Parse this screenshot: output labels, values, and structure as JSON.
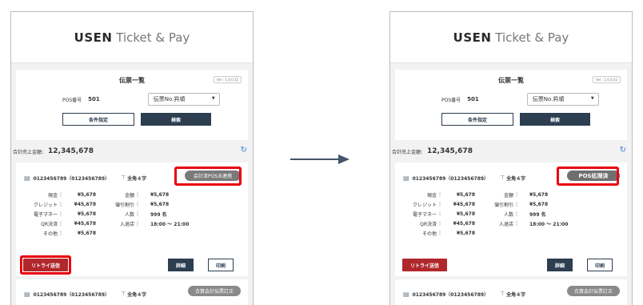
{
  "brand": {
    "bold": "USEN",
    "light": "Ticket & Pay"
  },
  "list": {
    "title": "伝票一覧",
    "version": "Ver : 1.0.0.32",
    "pos_label": "POS番号",
    "pos_number": "501",
    "sort_value": "伝票No.昇順",
    "cond_button": "条件指定",
    "search_button": "検索"
  },
  "totals": {
    "label": "合計売上金額：",
    "value": "12,345,678"
  },
  "card": {
    "slip": "0123456789（0123456789）",
    "table": "全角４字",
    "rows": [
      {
        "label": "現金",
        "value": "¥5,678",
        "label2": "金額",
        "value2": "¥5,678"
      },
      {
        "label": "クレジット",
        "value": "¥45,678",
        "label2": "値引割引",
        "value2": "¥5,678"
      },
      {
        "label": "電子マネー",
        "value": "¥5,678",
        "label2": "人数",
        "value2": "999 名"
      },
      {
        "label": "QR決済",
        "value": "¥45,678",
        "label2": "入退店",
        "value2": "18:00 ～ 21:00"
      },
      {
        "label": "その他",
        "value": "¥5,678",
        "label2": "",
        "value2": ""
      }
    ],
    "retry_button": "リトライ送信",
    "detail_button": "詳細",
    "print_button": "印刷"
  },
  "left": {
    "status": "会計済POS未連携"
  },
  "right": {
    "status": "POS処理済"
  },
  "card2": {
    "slip": "0123456789（0123456789）",
    "table": "全角４字",
    "status": "合算会計伝票訂正"
  },
  "colors": {
    "highlight": "#e8000e",
    "navy": "#2c3e50",
    "retry": "#b0282c"
  }
}
